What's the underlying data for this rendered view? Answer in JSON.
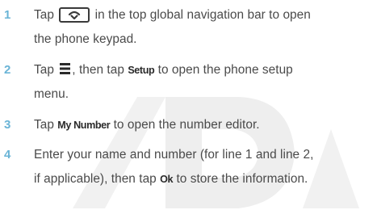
{
  "steps": [
    {
      "number": "1",
      "before_icon": "Tap ",
      "icon": "phone-keypad-icon",
      "after_icon_line1": " in the top global navigation bar to open",
      "line2": "the phone keypad."
    },
    {
      "number": "2",
      "before_icon": "Tap ",
      "icon": "menu-icon",
      "after_icon": ", then tap ",
      "keyword": "Setup",
      "after_keyword_line1": " to open the phone setup",
      "line2": "menu."
    },
    {
      "number": "3",
      "before_keyword": "Tap ",
      "keyword": "My Number",
      "after_keyword": " to open the number editor."
    },
    {
      "number": "4",
      "line1": "Enter your name and number (for line 1 and line 2,",
      "line2_before": "if applicable), then tap ",
      "keyword": "Ok",
      "line2_after": " to store the information."
    }
  ],
  "colors": {
    "number": "#6ab4d6",
    "text": "#4a4a4a",
    "watermark": "#eeeeee"
  }
}
